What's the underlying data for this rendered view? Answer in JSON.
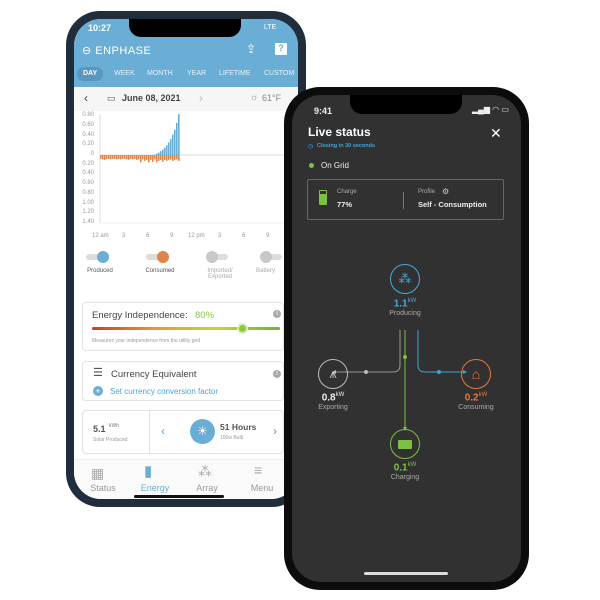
{
  "left_phone": {
    "status_time": "10:27",
    "carrier": "LTE",
    "brand": "ENPHASE",
    "tabs": [
      "DAY",
      "WEEK",
      "MONTH",
      "YEAR",
      "LIFETIME",
      "CUSTOM"
    ],
    "active_tab": "DAY",
    "date": "June 08, 2021",
    "weather": "61°F",
    "chart_data": {
      "type": "bar",
      "ylim": [
        -1.4,
        0.8
      ],
      "y_ticks": [
        "0.80",
        "0.60",
        "0.40",
        "0.20",
        "0",
        "0.20",
        "0.40",
        "0.60",
        "0.80",
        "1.00",
        "1.20",
        "1.40"
      ],
      "x_ticks": [
        "12 am",
        "3",
        "6",
        "9",
        "12 pm",
        "3",
        "6",
        "9"
      ],
      "x_hours": [
        0,
        0.25,
        0.5,
        0.75,
        1,
        1.25,
        1.5,
        1.75,
        2,
        2.25,
        2.5,
        2.75,
        3,
        3.25,
        3.5,
        3.75,
        4,
        4.25,
        4.5,
        4.75,
        5,
        5.25,
        5.5,
        5.75,
        6,
        6.25,
        6.5,
        6.75,
        7,
        7.25,
        7.5,
        7.75,
        8,
        8.25,
        8.5,
        8.75,
        9,
        9.25,
        9.5,
        9.75
      ],
      "series": [
        {
          "name": "Produced",
          "color": "#6aaed6",
          "values": [
            0,
            0,
            0,
            0,
            0,
            0,
            0,
            0,
            0,
            0,
            0,
            0,
            0,
            0,
            0,
            0,
            0,
            0,
            0,
            0,
            0,
            0,
            0,
            0,
            0,
            0,
            0,
            0.01,
            0.03,
            0.05,
            0.08,
            0.11,
            0.15,
            0.2,
            0.26,
            0.33,
            0.42,
            0.52,
            0.66,
            0.84
          ]
        },
        {
          "name": "Consumed",
          "color": "#e0854a",
          "values": [
            -0.08,
            -0.09,
            -0.1,
            -0.08,
            -0.08,
            -0.09,
            -0.08,
            -0.08,
            -0.09,
            -0.08,
            -0.09,
            -0.08,
            -0.08,
            -0.09,
            -0.1,
            -0.08,
            -0.09,
            -0.08,
            -0.1,
            -0.09,
            -0.15,
            -0.09,
            -0.12,
            -0.1,
            -0.15,
            -0.1,
            -0.14,
            -0.09,
            -0.15,
            -0.12,
            -0.1,
            -0.14,
            -0.1,
            -0.12,
            -0.1,
            -0.09,
            -0.12,
            -0.1,
            -0.09,
            -0.12
          ]
        }
      ]
    },
    "toggles": [
      {
        "label": "Produced",
        "on": true,
        "color": "#6aaed6"
      },
      {
        "label": "Consumed",
        "on": true,
        "color": "#e0854a"
      },
      {
        "label": "Imported/ Exported",
        "on": false
      },
      {
        "label": "Battery",
        "on": false
      }
    ],
    "independence": {
      "title": "Energy Independence:",
      "value": "80%",
      "level": 0.8,
      "caption": "Measures your independence from the utility grid"
    },
    "currency": {
      "title": "Currency Equivalent",
      "link": "Set currency conversion factor"
    },
    "solar": {
      "value": "5.1",
      "unit": "kWh",
      "caption": "Solar Produced",
      "equiv_value": "51 Hours",
      "equiv_caption": "100w Bulb"
    },
    "nav": [
      "Status",
      "Energy",
      "Array",
      "Menu"
    ],
    "active_nav": "Energy"
  },
  "right_phone": {
    "status_time": "9:41",
    "title": "Live status",
    "closing": "Closing in 30 seconds",
    "grid_status": "On Grid",
    "charge_label": "Charge",
    "charge_value": "77%",
    "profile_label": "Profile",
    "profile_value": "Self - Consumption",
    "producing": {
      "value": "1.1",
      "unit": "kW",
      "label": "Producing",
      "color": "#4aa8d8"
    },
    "exporting": {
      "value": "0.8",
      "unit": "kW",
      "label": "Exporting",
      "color": "#bbbbbb"
    },
    "consuming": {
      "value": "0.2",
      "unit": "kW",
      "label": "Consuming",
      "color": "#e9783a"
    },
    "charging": {
      "value": "0.1",
      "unit": "kW",
      "label": "Charging",
      "color": "#7cc142"
    }
  }
}
